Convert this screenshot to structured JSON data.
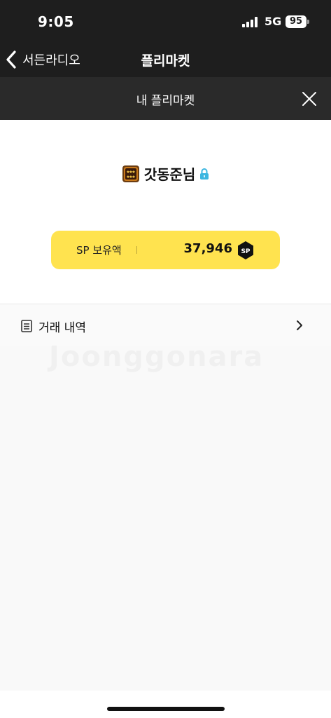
{
  "status_bar": {
    "time": "9:05",
    "network": "5G",
    "battery": "95"
  },
  "nav": {
    "back_label": "서든라디오",
    "title": "플리마켓"
  },
  "sub_header": {
    "title": "내 플리마켓"
  },
  "profile": {
    "username": "갓동준님",
    "sp_label": "SP 보유액",
    "sp_amount": "37,946",
    "sp_coin_label": "SP"
  },
  "menu": {
    "history_label": "거래 내역"
  },
  "watermark": "Joonggonara",
  "icons": {
    "back": "chevron-left-icon",
    "close": "close-icon",
    "rank": "rank-badge-icon",
    "lock": "lock-icon",
    "sp_coin": "sp-coin-icon",
    "history": "document-icon",
    "chevron": "chevron-right-icon"
  },
  "colors": {
    "header_bg": "#1e1e1e",
    "sub_header_bg": "#2a2a2a",
    "sp_pill": "#ffe34f",
    "lock": "#3bb6e0"
  }
}
